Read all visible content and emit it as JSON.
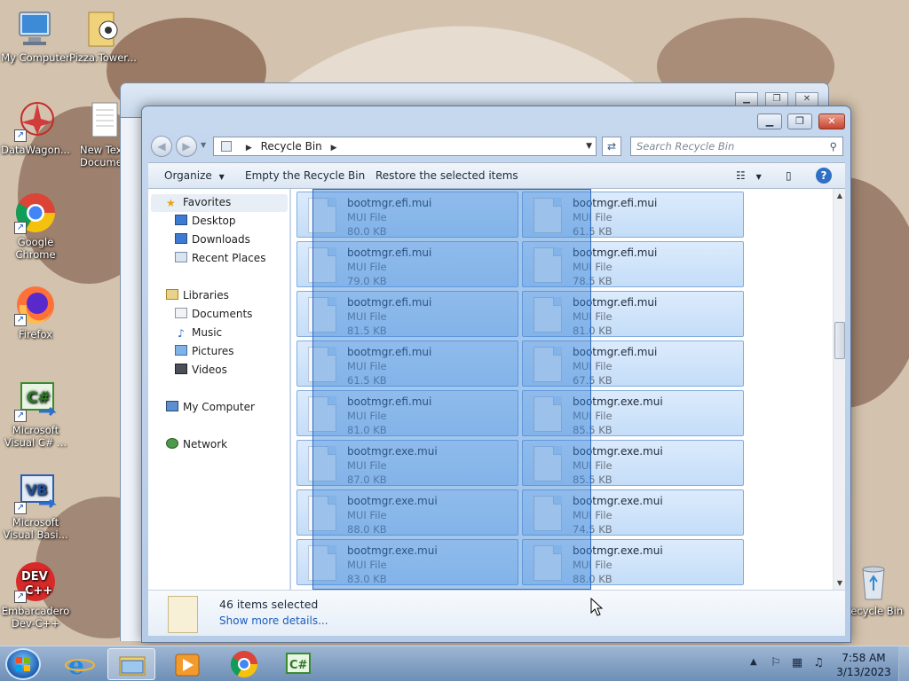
{
  "desktop": {
    "icons": [
      {
        "label": "My Computer",
        "icon": "computer-icon"
      },
      {
        "label": "Pizza.Tower...",
        "icon": "folder-icon"
      },
      {
        "label": "DataWagon...",
        "icon": "datawagon-icon"
      },
      {
        "label": "New Text Document",
        "icon": "text-document-icon"
      },
      {
        "label": "Google Chrome",
        "icon": "chrome-icon"
      },
      {
        "label": "Firefox",
        "icon": "firefox-icon"
      },
      {
        "label": "Microsoft Visual C# ...",
        "icon": "visual-csharp-icon"
      },
      {
        "label": "Microsoft Visual Basi...",
        "icon": "visual-basic-icon"
      },
      {
        "label": "Embarcadero Dev-C++",
        "icon": "dev-cpp-icon"
      },
      {
        "label": "Recycle Bin",
        "icon": "recycle-bin-icon"
      }
    ]
  },
  "window": {
    "address": {
      "location": "Recycle Bin"
    },
    "search": {
      "placeholder": "Search Recycle Bin"
    },
    "toolbar": {
      "organize": "Organize",
      "empty": "Empty the Recycle Bin",
      "restore": "Restore the selected items"
    },
    "nav": {
      "favorites": "Favorites",
      "favorites_items": [
        "Desktop",
        "Downloads",
        "Recent Places"
      ],
      "libraries": "Libraries",
      "libraries_items": [
        "Documents",
        "Music",
        "Pictures",
        "Videos"
      ],
      "computer": "My Computer",
      "network": "Network"
    },
    "files": [
      {
        "name": "bootmgr.efi.mui",
        "type": "MUI File",
        "size": "80.0 KB"
      },
      {
        "name": "bootmgr.efi.mui",
        "type": "MUI File",
        "size": "61.5 KB"
      },
      {
        "name": "bootmgr.efi.mui",
        "type": "MUI File",
        "size": "79.0 KB"
      },
      {
        "name": "bootmgr.efi.mui",
        "type": "MUI File",
        "size": "78.5 KB"
      },
      {
        "name": "bootmgr.efi.mui",
        "type": "MUI File",
        "size": "81.5 KB"
      },
      {
        "name": "bootmgr.efi.mui",
        "type": "MUI File",
        "size": "81.0 KB"
      },
      {
        "name": "bootmgr.efi.mui",
        "type": "MUI File",
        "size": "61.5 KB"
      },
      {
        "name": "bootmgr.efi.mui",
        "type": "MUI File",
        "size": "67.5 KB"
      },
      {
        "name": "bootmgr.efi.mui",
        "type": "MUI File",
        "size": "81.0 KB"
      },
      {
        "name": "bootmgr.exe.mui",
        "type": "MUI File",
        "size": "85.5 KB"
      },
      {
        "name": "bootmgr.exe.mui",
        "type": "MUI File",
        "size": "87.0 KB"
      },
      {
        "name": "bootmgr.exe.mui",
        "type": "MUI File",
        "size": "85.5 KB"
      },
      {
        "name": "bootmgr.exe.mui",
        "type": "MUI File",
        "size": "88.0 KB"
      },
      {
        "name": "bootmgr.exe.mui",
        "type": "MUI File",
        "size": "74.5 KB"
      },
      {
        "name": "bootmgr.exe.mui",
        "type": "MUI File",
        "size": "83.0 KB"
      },
      {
        "name": "bootmgr.exe.mui",
        "type": "MUI File",
        "size": "88.0 KB"
      }
    ],
    "details": {
      "selected_count": "46 items selected",
      "show_more": "Show more details..."
    }
  },
  "taskbar": {
    "apps": [
      "internet-explorer-icon",
      "windows-explorer-icon",
      "media-player-icon",
      "chrome-icon",
      "visual-csharp-icon"
    ],
    "clock": {
      "time": "7:58 AM",
      "date": "3/13/2023"
    }
  }
}
